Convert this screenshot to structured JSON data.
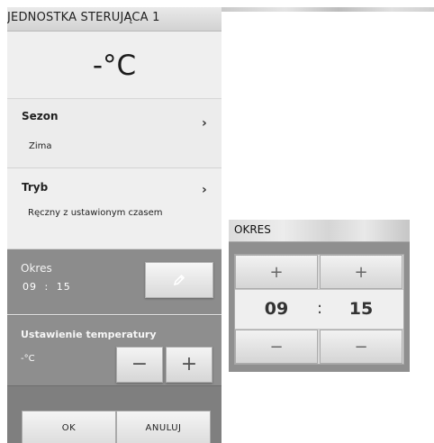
{
  "main_panel": {
    "header_title": "JEDNOSTKA STERUJĄCA 1",
    "current_temperature": "-°C",
    "sezon": {
      "title": "Sezon",
      "value": "Zima",
      "chevron": "›"
    },
    "tryb": {
      "title": "Tryb",
      "value": "Ręczny z ustawionym czasem",
      "chevron": "›"
    },
    "okres": {
      "label": "Okres",
      "hours": "09",
      "separator": ":",
      "minutes": "15",
      "edit_icon": "pencil-icon"
    },
    "ustawienie": {
      "label": "Ustawienie temperatury",
      "value": "-°C",
      "minus": "−",
      "plus": "+"
    },
    "footer": {
      "ok_label": "OK",
      "cancel_label": "ANULUJ"
    }
  },
  "period_popup": {
    "title": "OKRES",
    "hours": "09",
    "separator": ":",
    "minutes": "15",
    "plus": "+",
    "minus": "−"
  },
  "colors": {
    "panel_gray": "#8c8c8c",
    "light_row": "#eeeeee",
    "button_light": "#f2f2f2"
  }
}
